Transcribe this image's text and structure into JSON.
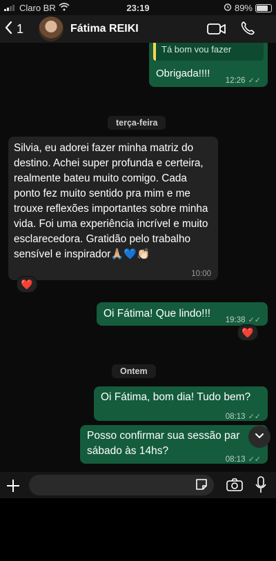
{
  "status_bar": {
    "carrier": "Claro BR",
    "time": "23:19",
    "battery": "89%",
    "battery_level": 0.89
  },
  "header": {
    "back_count": "1",
    "contact_name": "Fátima REIKI"
  },
  "messages": {
    "m1_quote": "Tá bom vou fazer",
    "m1_text": "Obrigada!!!!",
    "m1_time": "12:26",
    "day1": "terça-feira",
    "m2_text": "Silvia, eu adorei fazer minha matriz do destino. Achei super profunda e certeira, realmente bateu muito comigo. Cada ponto fez muito sentido pra mim e me trouxe reflexões importantes sobre minha vida. Foi uma experiência incrível e muito esclarecedora. Gratidão pelo trabalho sensível e inspirador🙏🏼💙👏🏻",
    "m2_time": "10:00",
    "m2_reaction": "❤️",
    "m3_text": "Oi Fátima! Que lindo!!!",
    "m3_time": "19:38",
    "m3_reaction": "❤️",
    "day2": "Ontem",
    "m4_text": "Oi Fátima, bom dia! Tudo bem?",
    "m4_time": "08:13",
    "m5_text": "Posso confirmar sua sessão par sábado às 14hs?",
    "m5_time": "08:13"
  },
  "colors": {
    "outgoing": "#145c3c",
    "incoming": "#232323",
    "reaction": "#e8344b"
  }
}
